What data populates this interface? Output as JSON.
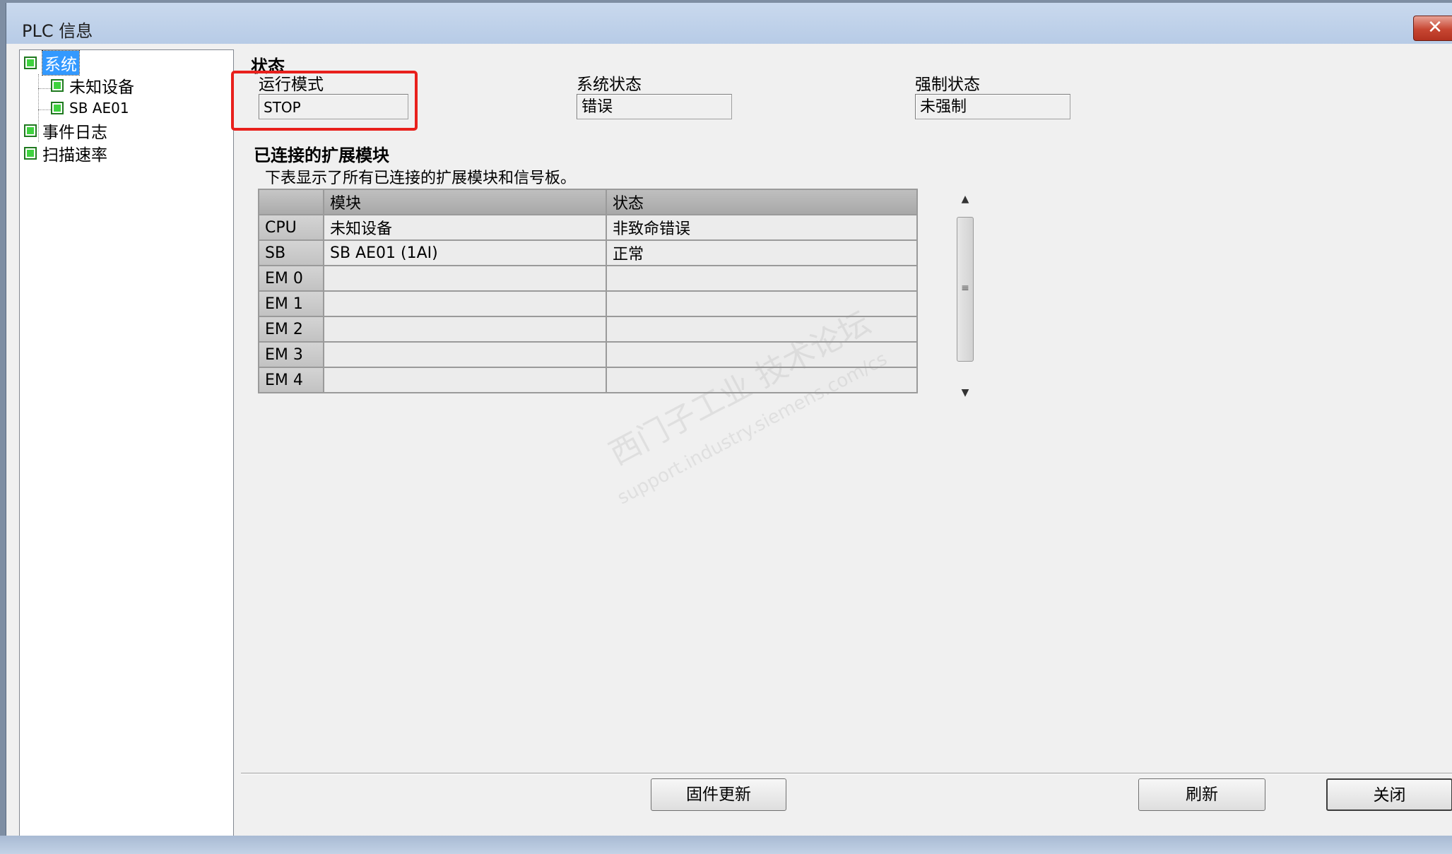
{
  "window": {
    "title": "PLC 信息",
    "close_glyph": "✕"
  },
  "tree": {
    "items": [
      {
        "label": "系统",
        "selected": true
      },
      {
        "label": "未知设备"
      },
      {
        "label": "SB AE01"
      },
      {
        "label": "事件日志"
      },
      {
        "label": "扫描速率"
      }
    ]
  },
  "status": {
    "section_title": "状态",
    "run_mode_label": "运行模式",
    "run_mode_value": "STOP",
    "system_state_label": "系统状态",
    "system_state_value": "错误",
    "force_state_label": "强制状态",
    "force_state_value": "未强制"
  },
  "modules": {
    "section_title": "已连接的扩展模块",
    "description": "下表显示了所有已连接的扩展模块和信号板。",
    "columns": [
      "",
      "模块",
      "状态"
    ],
    "rows": [
      {
        "slot": "CPU",
        "module": "未知设备",
        "state": "非致命错误"
      },
      {
        "slot": "SB",
        "module": "SB AE01 (1AI)",
        "state": "正常"
      },
      {
        "slot": "EM 0",
        "module": "",
        "state": ""
      },
      {
        "slot": "EM 1",
        "module": "",
        "state": ""
      },
      {
        "slot": "EM 2",
        "module": "",
        "state": ""
      },
      {
        "slot": "EM 3",
        "module": "",
        "state": ""
      },
      {
        "slot": "EM 4",
        "module": "",
        "state": ""
      }
    ]
  },
  "buttons": {
    "firmware_update": "固件更新",
    "refresh": "刷新",
    "close": "关闭"
  },
  "watermark": {
    "line1": "西门子工业 技术论坛",
    "line2": "support.industry.siemens.com/cs"
  },
  "colors": {
    "highlight": "#e8201c",
    "selection": "#3399ff",
    "node_icon": "#3fd23f"
  }
}
